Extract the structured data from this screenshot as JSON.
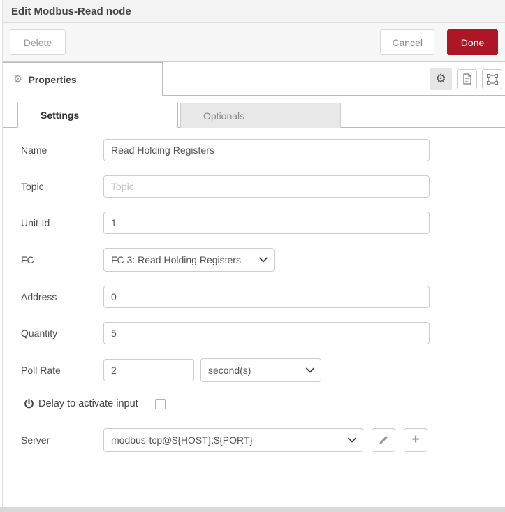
{
  "header": {
    "title": "Edit Modbus-Read node"
  },
  "toolbar": {
    "delete_label": "Delete",
    "cancel_label": "Cancel",
    "done_label": "Done",
    "done_color": "#AD1625"
  },
  "editor_tabs": {
    "properties_label": "Properties"
  },
  "subtabs": {
    "settings_label": "Settings",
    "optionals_label": "Optionals"
  },
  "form": {
    "name": {
      "label": "Name",
      "value": "Read Holding Registers"
    },
    "topic": {
      "label": "Topic",
      "placeholder": "Topic"
    },
    "unit_id": {
      "label": "Unit-Id",
      "value": "1"
    },
    "fc": {
      "label": "FC",
      "value": "FC 3: Read Holding Registers"
    },
    "address": {
      "label": "Address",
      "value": "0"
    },
    "quantity": {
      "label": "Quantity",
      "value": "5"
    },
    "poll_rate": {
      "label": "Poll Rate",
      "value": "2",
      "unit_value": "second(s)"
    },
    "delay": {
      "label": "Delay to activate input",
      "checked": false
    },
    "server": {
      "label": "Server",
      "value": "modbus-tcp@${HOST}:${PORT}"
    }
  },
  "icons": {
    "gear": "⚙",
    "plus": "+"
  }
}
